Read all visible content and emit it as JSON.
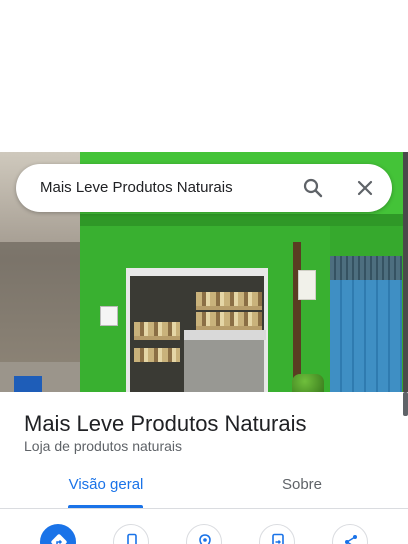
{
  "search": {
    "query": "Mais Leve Produtos Naturais",
    "icons": {
      "search": "search-icon",
      "close": "close-icon"
    }
  },
  "place": {
    "name": "Mais Leve Produtos Naturais",
    "category": "Loja de produtos naturais"
  },
  "tabs": [
    {
      "label": "Visão geral",
      "selected": true
    },
    {
      "label": "Sobre",
      "selected": false
    }
  ],
  "actions": [
    {
      "icon": "directions-icon",
      "primary": true
    },
    {
      "icon": "phone-icon",
      "primary": false
    },
    {
      "icon": "save-place-icon",
      "primary": false
    },
    {
      "icon": "send-to-phone-icon",
      "primary": false
    },
    {
      "icon": "share-icon",
      "primary": false
    }
  ],
  "colors": {
    "accent": "#1a73e8",
    "title_text": "#202124",
    "secondary_text": "#5f6368",
    "storefront_green": "#39b030"
  }
}
